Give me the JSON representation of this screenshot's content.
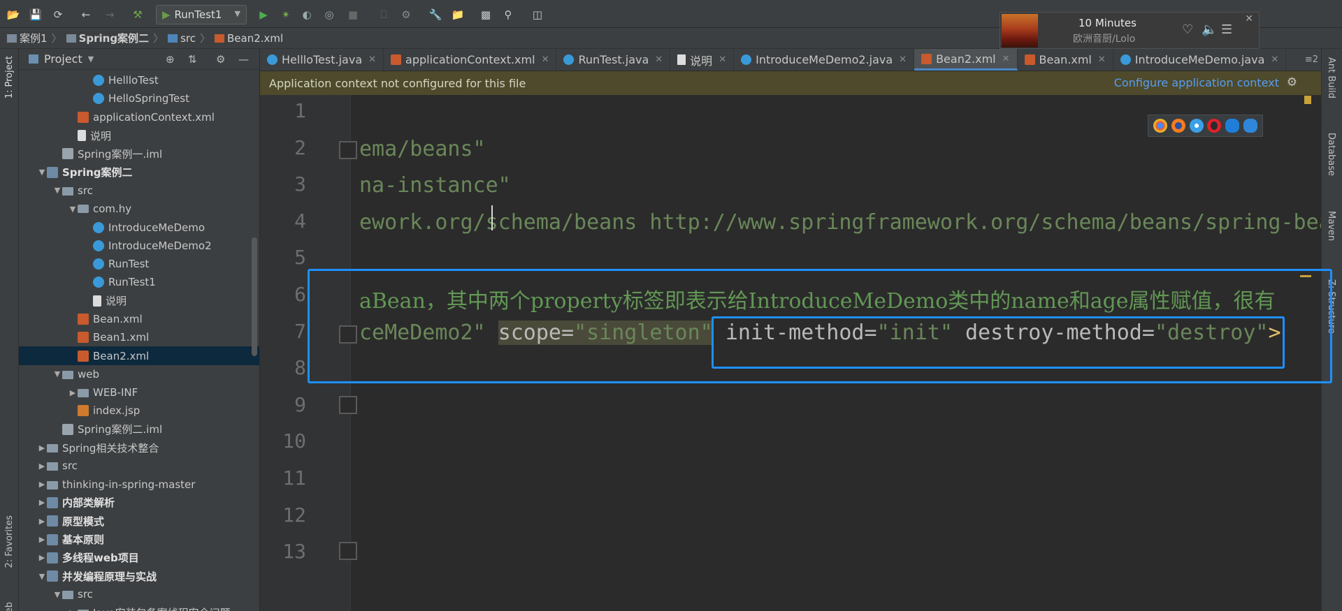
{
  "toolbar": {
    "run_config": "RunTest1"
  },
  "music": {
    "title": "10 Minutes",
    "artist": "欧洲音厨/Lolo"
  },
  "breadcrumb": [
    "案例1",
    "Spring案例二",
    "src",
    "Bean2.xml"
  ],
  "left_strip": {
    "project": "1: Project",
    "favorites": "2: Favorites",
    "web": "Web"
  },
  "project_panel": {
    "title": "Project",
    "rows": [
      {
        "label": "HellloTest",
        "icon": "class-icon",
        "indent": 4
      },
      {
        "label": "HelloSpringTest",
        "icon": "class-icon",
        "indent": 4
      },
      {
        "label": "applicationContext.xml",
        "icon": "xml-file-icon",
        "indent": 3
      },
      {
        "label": "说明",
        "icon": "text-file-icon",
        "indent": 3
      },
      {
        "label": "Spring案例一.iml",
        "icon": "iml-file-icon",
        "indent": 2
      },
      {
        "label": "Spring案例二",
        "icon": "module-icon",
        "indent": 1,
        "expanded": true,
        "bold": true
      },
      {
        "label": "src",
        "icon": "folder-icon",
        "indent": 2,
        "expanded": true
      },
      {
        "label": "com.hy",
        "icon": "package-icon",
        "indent": 3,
        "expanded": true
      },
      {
        "label": "IntroduceMeDemo",
        "icon": "class-icon",
        "indent": 4
      },
      {
        "label": "IntroduceMeDemo2",
        "icon": "class-icon",
        "indent": 4
      },
      {
        "label": "RunTest",
        "icon": "class-icon",
        "indent": 4
      },
      {
        "label": "RunTest1",
        "icon": "class-icon",
        "indent": 4
      },
      {
        "label": "说明",
        "icon": "text-file-icon",
        "indent": 4
      },
      {
        "label": "Bean.xml",
        "icon": "xml-file-icon",
        "indent": 3
      },
      {
        "label": "Bean1.xml",
        "icon": "xml-file-icon",
        "indent": 3
      },
      {
        "label": "Bean2.xml",
        "icon": "xml-file-icon",
        "indent": 3,
        "selected": true
      },
      {
        "label": "web",
        "icon": "folder-icon",
        "indent": 2,
        "expanded": true
      },
      {
        "label": "WEB-INF",
        "icon": "folder-icon",
        "indent": 3,
        "collapsed": true
      },
      {
        "label": "index.jsp",
        "icon": "jsp-file-icon",
        "indent": 3
      },
      {
        "label": "Spring案例二.iml",
        "icon": "iml-file-icon",
        "indent": 2
      },
      {
        "label": "Spring相关技术整合",
        "icon": "folder-icon",
        "indent": 1,
        "collapsed": true
      },
      {
        "label": "src",
        "icon": "folder-icon",
        "indent": 1,
        "collapsed": true
      },
      {
        "label": "thinking-in-spring-master",
        "icon": "folder-icon",
        "indent": 1,
        "collapsed": true
      },
      {
        "label": "内部类解析",
        "icon": "module-icon",
        "indent": 1,
        "collapsed": true,
        "bold": true
      },
      {
        "label": "原型模式",
        "icon": "module-icon",
        "indent": 1,
        "collapsed": true,
        "bold": true
      },
      {
        "label": "基本原则",
        "icon": "module-icon",
        "indent": 1,
        "collapsed": true,
        "bold": true
      },
      {
        "label": "多线程web项目",
        "icon": "module-icon",
        "indent": 1,
        "collapsed": true,
        "bold": true
      },
      {
        "label": "并发编程原理与实战",
        "icon": "module-icon",
        "indent": 1,
        "expanded": true,
        "bold": true
      },
      {
        "label": "src",
        "icon": "folder-icon",
        "indent": 2,
        "expanded": true
      },
      {
        "label": "Java安装包备案线程安全问题",
        "icon": "folder-icon",
        "indent": 3,
        "collapsed": true
      }
    ]
  },
  "tabs": [
    {
      "label": "HellloTest.java",
      "icon": "class"
    },
    {
      "label": "applicationContext.xml",
      "icon": "xml"
    },
    {
      "label": "RunTest.java",
      "icon": "class"
    },
    {
      "label": "说明",
      "icon": "txt"
    },
    {
      "label": "IntroduceMeDemo2.java",
      "icon": "class"
    },
    {
      "label": "Bean2.xml",
      "icon": "xml",
      "active": true
    },
    {
      "label": "Bean.xml",
      "icon": "xml"
    },
    {
      "label": "IntroduceMeDemo.java",
      "icon": "class"
    }
  ],
  "tabs_overflow": "≡2",
  "banner": {
    "message": "Application context not configured for this file",
    "action": "Configure application context"
  },
  "editor": {
    "line_numbers": [
      "1",
      "2",
      "3",
      "4",
      "5",
      "6",
      "7",
      "8",
      "9",
      "10",
      "11",
      "12",
      "13"
    ],
    "line2": "ema/beans\"",
    "line3": "na-instance\"",
    "line4": "ework.org/schema/beans http://www.springframework.org/schema/beans/spring-bea",
    "line6": "aBean，其中两个property标签即表示给IntroduceMeDemo类中的name和age属性赋值，很有",
    "line7a": "ceMeDemo2\"",
    "line7_scope_attr": "scope=",
    "line7_scope_val": "\"singleton\"",
    "line7_init_attr": "init-method=",
    "line7_init_val": "\"init\"",
    "line7_destroy_attr": "destroy-method=",
    "line7_destroy_val": "\"destroy\"",
    "line7_end": ">"
  },
  "right_strip": {
    "ant": "Ant Build",
    "database": "Database",
    "maven": "Maven",
    "structure": "Z: Structure"
  },
  "colors": {
    "highlight_box": "#1e90ff",
    "banner_bg": "#4e4a2b",
    "selection": "#0d293e"
  }
}
